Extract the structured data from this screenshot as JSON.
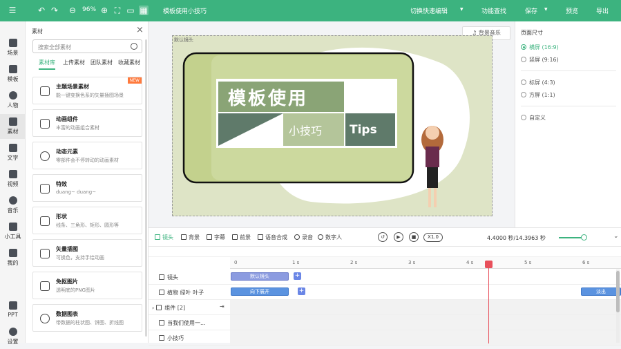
{
  "app": {
    "title": "模板使用小技巧",
    "zoom": "96%"
  },
  "header": {
    "quick_edit": "切换快速编辑",
    "feature_search": "功能查找",
    "save": "保存",
    "preview": "预览",
    "export": "导出"
  },
  "left_nav": [
    {
      "label": "场景"
    },
    {
      "label": "模板"
    },
    {
      "label": "人物"
    },
    {
      "label": "素材"
    },
    {
      "label": "文字"
    },
    {
      "label": "视频"
    },
    {
      "label": "音乐"
    },
    {
      "label": "小工具"
    },
    {
      "label": "我的"
    },
    {
      "label": "PPT"
    },
    {
      "label": "设置"
    }
  ],
  "asset_panel": {
    "title": "素材",
    "search_placeholder": "搜索全部素材",
    "tabs": [
      "素材库",
      "上传素材",
      "团队素材",
      "收藏素材"
    ],
    "cards": [
      {
        "title": "主题场景素材",
        "desc": "能一键变换色系的矢量插图场景",
        "badge": "NEW"
      },
      {
        "title": "动画组件",
        "desc": "丰富的动画组合素材"
      },
      {
        "title": "动态元素",
        "desc": "零部件会不停转动的动画素材"
      },
      {
        "title": "特效",
        "desc": "duang~ duang~"
      },
      {
        "title": "形状",
        "desc": "线条、三角形、矩形、圆形等"
      },
      {
        "title": "矢量插图",
        "desc": "可换色，支持手绘动画"
      },
      {
        "title": "免抠图片",
        "desc": "透明底的PNG图片"
      },
      {
        "title": "数据图表",
        "desc": "带数据的柱状图、饼图、折线图"
      }
    ]
  },
  "canvas": {
    "label": "默认镜头",
    "bg_music": "背景音乐",
    "slide": {
      "title": "模板使用",
      "subtitle": "小技巧",
      "tips": "Tips"
    }
  },
  "page_size": {
    "title": "页面尺寸",
    "options": [
      "横屏 (16:9)",
      "竖屏 (9:16)",
      "标屏 (4:3)",
      "方屏 (1:1)",
      "自定义"
    ],
    "selected": "横屏 (16:9)"
  },
  "timeline": {
    "tabs": [
      "镜头",
      "背景",
      "字幕",
      "前景",
      "语音合成",
      "录音",
      "数字人"
    ],
    "speed": "X1.0",
    "time_readout": "4.4000 秒/14.3963 秒",
    "ticks": [
      "0",
      "1 s",
      "2 s",
      "3 s",
      "4 s",
      "5 s",
      "6 s"
    ],
    "rows": [
      {
        "name": "镜头",
        "clip": "默认镜头"
      },
      {
        "name": "植物 绿叶 叶子",
        "clip": "向下展开",
        "clip2": "淡出"
      },
      {
        "name": "组件 [2]"
      },
      {
        "name": "当我们使用一..."
      },
      {
        "name": "小技巧"
      }
    ],
    "playhead_seconds": 4.4
  },
  "colors": {
    "accent": "#3cb37f",
    "clip": "#8b9be0",
    "playhead": "#e8505b"
  }
}
